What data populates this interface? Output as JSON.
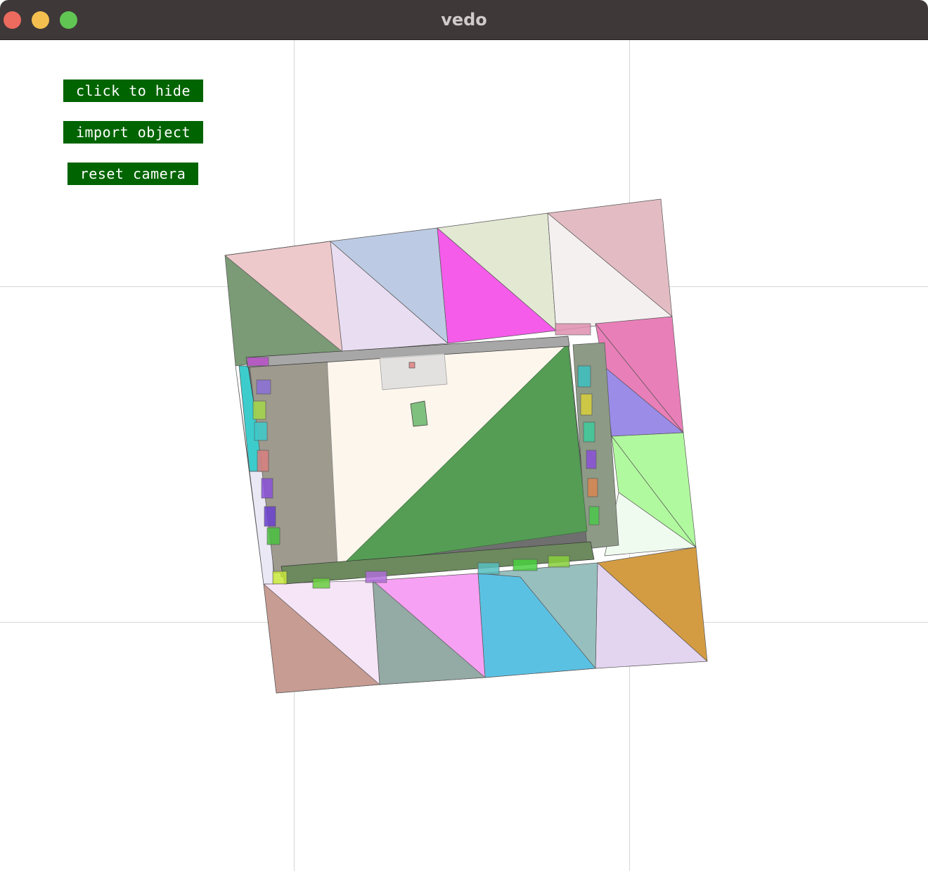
{
  "window": {
    "title": "vedo"
  },
  "buttons": [
    {
      "label": "click to hide"
    },
    {
      "label": "import object"
    },
    {
      "label": "reset camera"
    }
  ],
  "colors": {
    "titlebar": "#3f3838",
    "button_bg": "#006400",
    "button_text": "#ffffff",
    "traffic_close": "#ec6a5e",
    "traffic_min": "#f4bf4f",
    "traffic_max": "#61c554"
  }
}
